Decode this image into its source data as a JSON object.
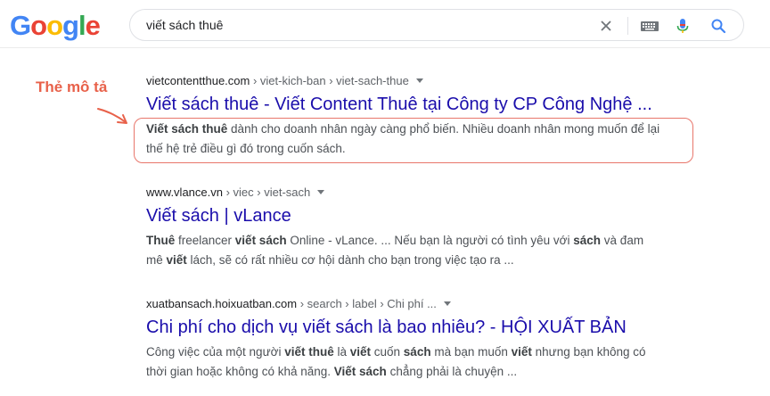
{
  "header": {
    "logo_letters": [
      {
        "char": "G",
        "color": "#4285F4"
      },
      {
        "char": "o",
        "color": "#EA4335"
      },
      {
        "char": "o",
        "color": "#FBBC05"
      },
      {
        "char": "g",
        "color": "#4285F4"
      },
      {
        "char": "l",
        "color": "#34A853"
      },
      {
        "char": "e",
        "color": "#EA4335"
      }
    ],
    "search_query": "viết sách thuê",
    "icons": [
      "close-icon",
      "keyboard-icon",
      "microphone-icon",
      "search-icon"
    ]
  },
  "annotation": {
    "label": "Thẻ mô tả",
    "color": "#e8614a"
  },
  "results": [
    {
      "site": "vietcontentthue.com",
      "path": " › viet-kich-ban › viet-sach-thue",
      "title": "Viết sách thuê - Viết Content Thuê tại Công ty CP Công Nghệ ...",
      "snippet_lines": [
        [
          {
            "t": "Viết sách thuê",
            "b": true
          },
          {
            "t": " dành cho doanh nhân ngày càng phổ biến. Nhiều doanh nhân mong muốn để lại",
            "b": false
          }
        ],
        [
          {
            "t": "thế hệ trẻ điều gì đó trong cuốn sách.",
            "b": false
          }
        ]
      ]
    },
    {
      "site": "www.vlance.vn",
      "path": " › viec › viet-sach",
      "title": "Viết sách | vLance",
      "snippet_lines": [
        [
          {
            "t": "Thuê",
            "b": true
          },
          {
            "t": " freelancer ",
            "b": false
          },
          {
            "t": "viết sách",
            "b": true
          },
          {
            "t": " Online - vLance. ... Nếu bạn là người có tình yêu với ",
            "b": false
          },
          {
            "t": "sách",
            "b": true
          },
          {
            "t": " và đam",
            "b": false
          }
        ],
        [
          {
            "t": "mê ",
            "b": false
          },
          {
            "t": "viết",
            "b": true
          },
          {
            "t": " lách, sẽ có rất nhiều cơ hội dành cho bạn trong việc tạo ra ...",
            "b": false
          }
        ]
      ]
    },
    {
      "site": "xuatbansach.hoixuatban.com",
      "path": " › search › label › Chi phí ...",
      "title": "Chi phí cho dịch vụ viết sách là bao nhiêu? - HỘI XUẤT BẢN",
      "snippet_lines": [
        [
          {
            "t": "Công việc của một người ",
            "b": false
          },
          {
            "t": "viết thuê",
            "b": true
          },
          {
            "t": " là ",
            "b": false
          },
          {
            "t": "viết",
            "b": true
          },
          {
            "t": " cuốn ",
            "b": false
          },
          {
            "t": "sách",
            "b": true
          },
          {
            "t": " mà bạn muốn ",
            "b": false
          },
          {
            "t": "viết",
            "b": true
          },
          {
            "t": " nhưng bạn không có",
            "b": false
          }
        ],
        [
          {
            "t": "thời gian hoặc không có khả năng. ",
            "b": false
          },
          {
            "t": "Viết sách",
            "b": true
          },
          {
            "t": " chẳng phải là chuyện ...",
            "b": false
          }
        ]
      ]
    }
  ]
}
